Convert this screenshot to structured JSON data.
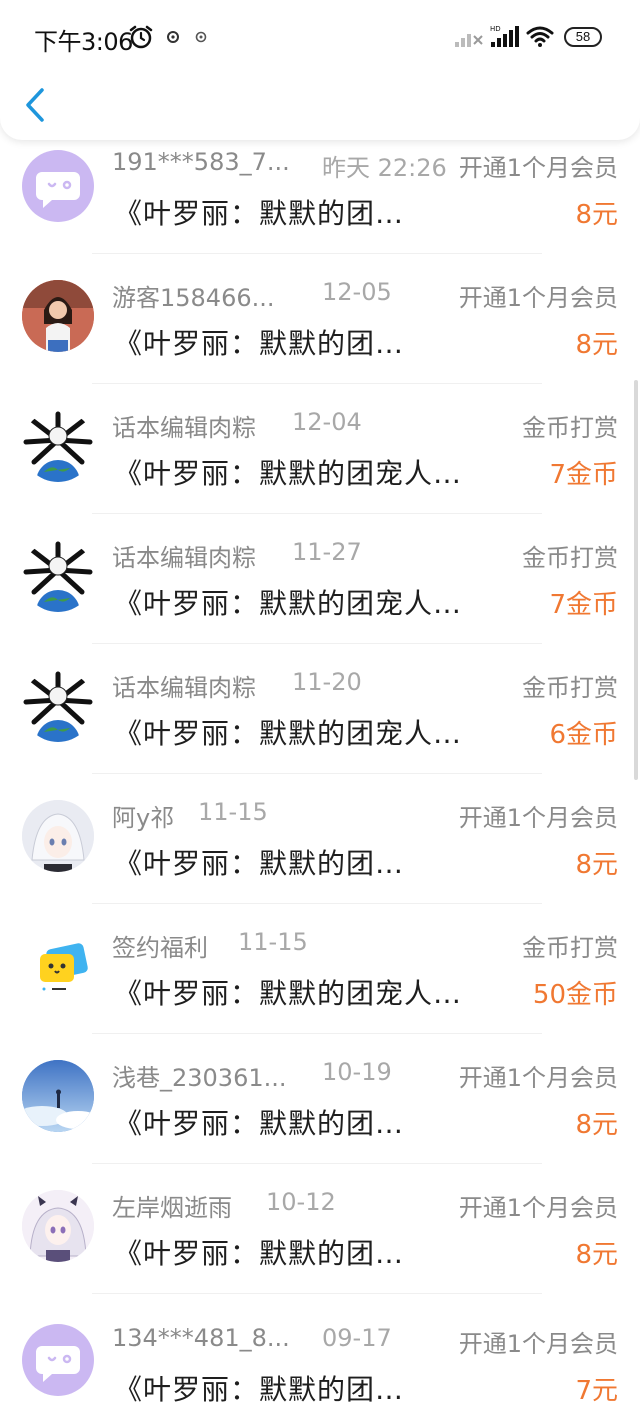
{
  "status_bar": {
    "time": "下午3:06",
    "battery": "58"
  },
  "colors": {
    "accent": "#1e96dc",
    "amount": "#f07832",
    "muted": "#8a8a8a"
  },
  "items": [
    {
      "avatar": "chat-bubble-icon",
      "name": "191***583_7...",
      "date": "昨天 22:26",
      "kind": "开通1个月会员",
      "book": "《叶罗丽：默默的团…",
      "amount": "8元"
    },
    {
      "avatar": "user-photo",
      "name": "游客158466...",
      "date": "12-05",
      "kind": "开通1个月会员",
      "book": "《叶罗丽：默默的团…",
      "amount": "8元"
    },
    {
      "avatar": "earth-creature",
      "name": "话本编辑肉粽",
      "date": "12-04",
      "kind": "金币打赏",
      "book": "《叶罗丽：默默的团宠人…",
      "amount": "7金币"
    },
    {
      "avatar": "earth-creature",
      "name": "话本编辑肉粽",
      "date": "11-27",
      "kind": "金币打赏",
      "book": "《叶罗丽：默默的团宠人…",
      "amount": "7金币"
    },
    {
      "avatar": "earth-creature",
      "name": "话本编辑肉粽",
      "date": "11-20",
      "kind": "金币打赏",
      "book": "《叶罗丽：默默的团宠人…",
      "amount": "6金币"
    },
    {
      "avatar": "anime-girl-white",
      "name": "阿y祁",
      "date": "11-15",
      "kind": "开通1个月会员",
      "book": "《叶罗丽：默默的团…",
      "amount": "8元"
    },
    {
      "avatar": "yellow-sign-icon",
      "name": "签约福利",
      "date": "11-15",
      "kind": "金币打赏",
      "book": "《叶罗丽：默默的团宠人…",
      "amount": "50金币"
    },
    {
      "avatar": "sky-scene",
      "name": "浅巷_230361...",
      "date": "10-19",
      "kind": "开通1个月会员",
      "book": "《叶罗丽：默默的团…",
      "amount": "8元"
    },
    {
      "avatar": "anime-girl-bow",
      "name": "左岸烟逝雨",
      "date": "10-12",
      "kind": "开通1个月会员",
      "book": "《叶罗丽：默默的团…",
      "amount": "8元"
    },
    {
      "avatar": "chat-bubble-icon",
      "name": "134***481_8...",
      "date": "09-17",
      "kind": "开通1个月会员",
      "book": "《叶罗丽：默默的团…",
      "amount": "7元"
    }
  ]
}
